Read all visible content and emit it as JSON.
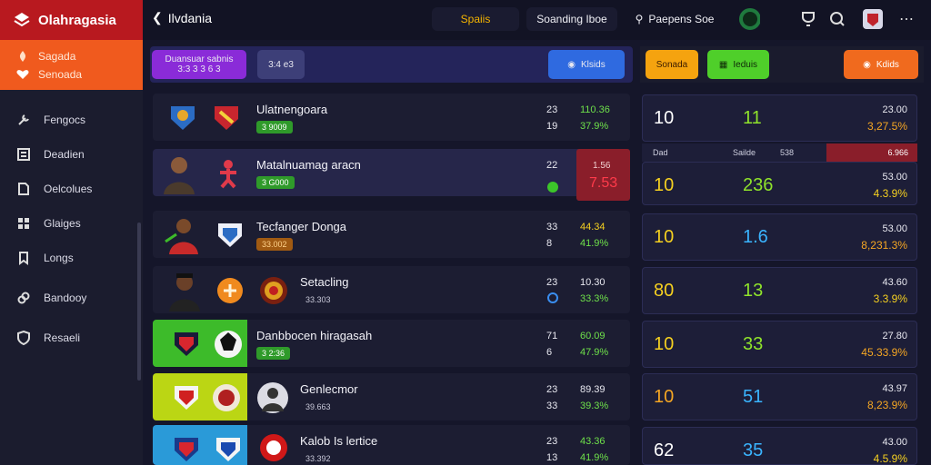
{
  "sidebar": {
    "brand": "Olahragasia",
    "promo": [
      "Sagada",
      "Senoada"
    ],
    "items": [
      {
        "label": "Fengocs",
        "icon": "tools-icon"
      },
      {
        "label": "Deadien",
        "icon": "list-icon"
      },
      {
        "label": "Oelcolues",
        "icon": "document-icon"
      },
      {
        "label": "Glaiges",
        "icon": "grid-icon"
      },
      {
        "label": "Longs",
        "icon": "bookmark-icon"
      },
      {
        "label": "Bandooy",
        "icon": "link-icon"
      },
      {
        "label": "Resaeli",
        "icon": "shield-icon"
      }
    ]
  },
  "topbar": {
    "back_label": "Ilvdania",
    "pill1": "Spaiis",
    "pill2": "Soanding Iboe",
    "pill3": "Paepens Soe"
  },
  "filterbar": {
    "chip_profile": "Duansuar sabnis",
    "chip_profile_sub": "3:3 3 3 6 3",
    "chip_small": "3:4 e3",
    "chip_blue": "Klsids",
    "chip_orange1": "Sonada",
    "chip_green": "Ieduis",
    "chip_orange2": "Kdids"
  },
  "rows": [
    {
      "name": "Ulatnengoara",
      "tag": "3 9009",
      "n1": "23",
      "n2": "19",
      "o1": "110.36",
      "o2": "37.9%"
    },
    {
      "name": "Matalnuamag aracn",
      "tag": "3 G000",
      "n1": "22",
      "n2": "",
      "o1": "1.56",
      "o2": "7.53"
    },
    {
      "name": "Tecfanger Donga",
      "tag": "33.002",
      "n1": "33",
      "n2": "8",
      "o1": "44.34",
      "o2": "41.9%"
    },
    {
      "name": "Setacling",
      "tag": "33.303",
      "n1": "23",
      "n2": "",
      "o1": "10.30",
      "o2": "33.3%"
    },
    {
      "name": "Danbbocen hiragasah",
      "tag": "3 2:36",
      "n1": "71",
      "n2": "6",
      "o1": "60.09",
      "o2": "47.9%"
    },
    {
      "name": "Genlecmor",
      "tag": "39.663",
      "n1": "23",
      "n2": "33",
      "o1": "89.39",
      "o2": "39.3%"
    },
    {
      "name": "Kalob Is lertice",
      "tag": "33.392",
      "n1": "23",
      "n2": "13",
      "o1": "43.36",
      "o2": "41.9%"
    }
  ],
  "cards": [
    {
      "a": "10",
      "b": "11",
      "c1": "23.00",
      "c2": "3,27.5%",
      "ac": "#ffffff",
      "bc": "#8fe32b",
      "c2c": "#f5a623"
    },
    {
      "a": "10",
      "b": "236",
      "c1": "53.00",
      "c2": "4.3.9%",
      "ac": "#f5d020",
      "bc": "#8fe32b",
      "c2c": "#f5d020"
    },
    {
      "a": "10",
      "b": "1.6",
      "c1": "53.00",
      "c2": "8,231.3%",
      "ac": "#f5d020",
      "bc": "#3ab4ff",
      "c2c": "#f5a623"
    },
    {
      "a": "80",
      "b": "13",
      "c1": "43.60",
      "c2": "3.3.9%",
      "ac": "#f5d020",
      "bc": "#8fe32b",
      "c2c": "#f5d020"
    },
    {
      "a": "10",
      "b": "33",
      "c1": "27.80",
      "c2": "45.33.9%",
      "ac": "#f5d020",
      "bc": "#8fe32b",
      "c2c": "#f5a623"
    },
    {
      "a": "10",
      "b": "51",
      "c1": "43.97",
      "c2": "8,23.9%",
      "ac": "#f5a623",
      "bc": "#3ab4ff",
      "c2c": "#f5a623"
    },
    {
      "a": "62",
      "b": "35",
      "c1": "43.00",
      "c2": "4.5.9%",
      "ac": "#ffffff",
      "bc": "#3ab4ff",
      "c2c": "#f5d020"
    }
  ],
  "card_head": {
    "l1": "Dad",
    "l2": "Sailde",
    "l3": "538",
    "red": "6.966"
  }
}
